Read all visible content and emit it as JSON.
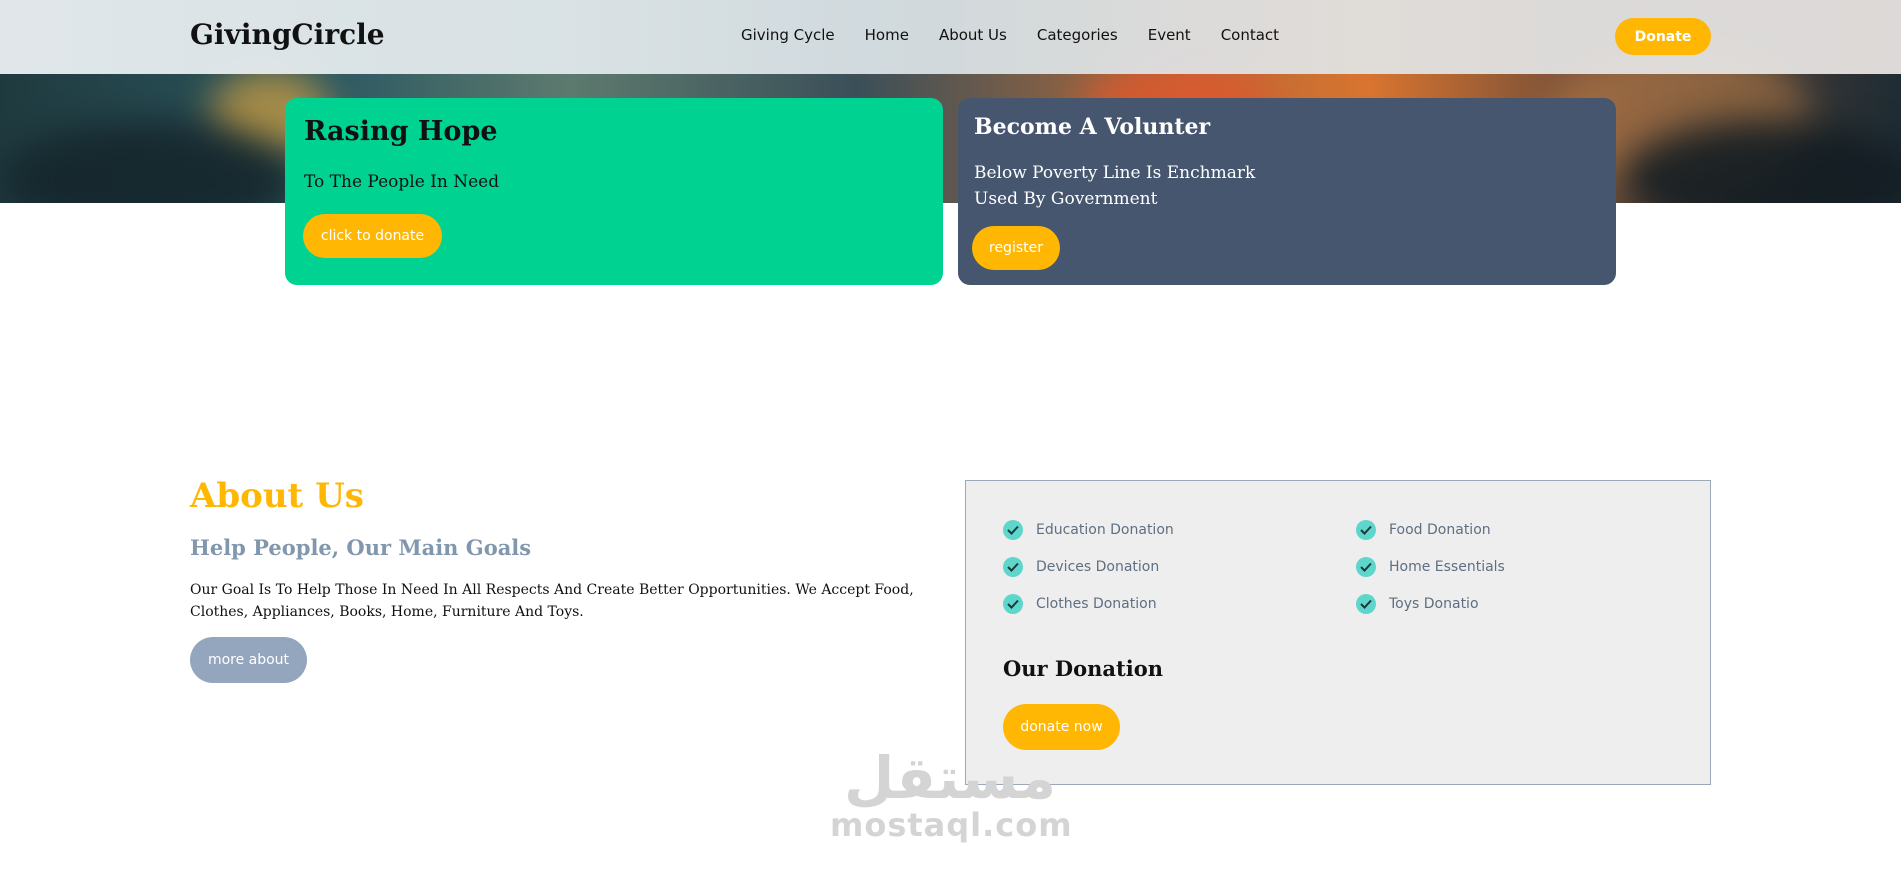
{
  "header": {
    "logo": "GivingCircle",
    "nav": [
      "Giving Cycle",
      "Home",
      "About Us",
      "Categories",
      "Event",
      "Contact"
    ],
    "donate_label": "Donate"
  },
  "hero": {
    "left_card": {
      "title": "Rasing Hope",
      "text": "To The People In Need",
      "button": "click to donate"
    },
    "right_card": {
      "title": "Become A Volunter",
      "text_line1": "Below Poverty Line Is Enchmark",
      "text_line2": "Used By Government",
      "button": "register"
    }
  },
  "about": {
    "title": "About Us",
    "subtitle": "Help People, Our Main Goals",
    "text": "Our Goal Is To Help Those In Need In All Respects And Create Better Opportunities. We Accept Food, Clothes, Appliances, Books, Home, Furniture And Toys.",
    "button": "more about"
  },
  "donation_panel": {
    "items": [
      "Education Donation",
      "Food Donation",
      "Devices Donation",
      "Home Essentials",
      "Clothes Donation",
      "Toys Donatio"
    ],
    "title": "Our Donation",
    "button": "donate now"
  },
  "watermark": {
    "arabic": "مستقل",
    "latin": "mostaql.com"
  },
  "colors": {
    "accent": "#ffb703",
    "green_card": "#00d391",
    "slate_card": "#46566f",
    "check": "#5fd6cc",
    "muted_button": "#94a6bd"
  }
}
